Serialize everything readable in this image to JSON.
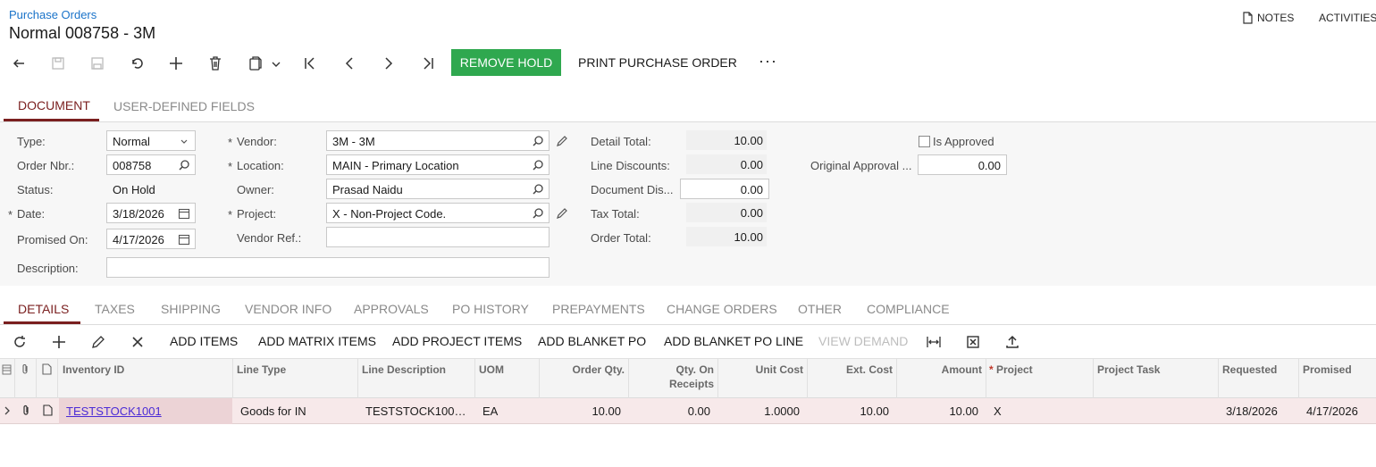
{
  "header": {
    "breadcrumb": "Purchase Orders",
    "title": "Normal 008758 - 3M",
    "notes": "NOTES",
    "activities": "ACTIVITIES"
  },
  "toolbar": {
    "remove_hold": "REMOVE HOLD",
    "print": "PRINT PURCHASE ORDER",
    "more": "···"
  },
  "tabs": {
    "document": "DOCUMENT",
    "user_defined": "USER-DEFINED FIELDS"
  },
  "form": {
    "type_label": "Type:",
    "type_value": "Normal",
    "order_nbr_label": "Order Nbr.:",
    "order_nbr_value": "008758",
    "status_label": "Status:",
    "status_value": "On Hold",
    "date_label": "Date:",
    "date_value": "3/18/2026",
    "promised_label": "Promised On:",
    "promised_value": "4/17/2026",
    "description_label": "Description:",
    "description_value": "",
    "vendor_label": "Vendor:",
    "vendor_value": "3M - 3M",
    "location_label": "Location:",
    "location_value": "MAIN - Primary Location",
    "owner_label": "Owner:",
    "owner_value": "Prasad Naidu",
    "project_label": "Project:",
    "project_value": "X - Non-Project Code.",
    "vendor_ref_label": "Vendor Ref.:",
    "vendor_ref_value": "",
    "detail_total_label": "Detail Total:",
    "detail_total_value": "10.00",
    "line_disc_label": "Line Discounts:",
    "line_disc_value": "0.00",
    "doc_disc_label": "Document Dis...",
    "doc_disc_value": "0.00",
    "tax_total_label": "Tax Total:",
    "tax_total_value": "0.00",
    "order_total_label": "Order Total:",
    "order_total_value": "10.00",
    "is_approved_label": "Is Approved",
    "orig_approval_label": "Original Approval ...",
    "orig_approval_value": "0.00",
    "required_mark": "*"
  },
  "detail_tabs": [
    "DETAILS",
    "TAXES",
    "SHIPPING",
    "VENDOR INFO",
    "APPROVALS",
    "PO HISTORY",
    "PREPAYMENTS",
    "CHANGE ORDERS",
    "OTHER",
    "COMPLIANCE"
  ],
  "grid_toolbar": {
    "add_items": "ADD ITEMS",
    "add_matrix": "ADD MATRIX ITEMS",
    "add_project": "ADD PROJECT ITEMS",
    "add_blanket": "ADD BLANKET PO",
    "add_blanket_line": "ADD BLANKET PO LINE",
    "view_demand": "VIEW DEMAND"
  },
  "grid": {
    "columns": {
      "inventory_id": "Inventory ID",
      "line_type": "Line Type",
      "line_desc": "Line Description",
      "uom": "UOM",
      "order_qty": "Order Qty.",
      "qty_receipts_1": "Qty. On",
      "qty_receipts_2": "Receipts",
      "unit_cost": "Unit Cost",
      "ext_cost": "Ext. Cost",
      "amount": "Amount",
      "project_star": "*",
      "project": "Project",
      "project_task": "Project Task",
      "requested": "Requested",
      "promised": "Promised"
    },
    "rows": [
      {
        "inventory_id": "TESTSTOCK1001",
        "line_type": "Goods for IN",
        "line_desc": "TESTSTOCK100…",
        "uom": "EA",
        "order_qty": "10.00",
        "qty_receipts": "0.00",
        "unit_cost": "1.0000",
        "ext_cost": "10.00",
        "amount": "10.00",
        "project": "X",
        "project_task": "",
        "requested": "3/18/2026",
        "promised": "4/17/2026"
      }
    ]
  },
  "icons": [
    "back-icon",
    "save-icon",
    "save-close-icon",
    "undo-icon",
    "add-icon",
    "delete-icon",
    "copy-paste-icon",
    "first-icon",
    "prev-icon",
    "next-icon",
    "last-icon",
    "search-icon",
    "calendar-icon",
    "pencil-icon",
    "refresh-icon",
    "close-icon",
    "fit-columns-icon",
    "export-excel-icon",
    "upload-icon",
    "note-icon",
    "paperclip-icon",
    "chevron-right-icon"
  ]
}
